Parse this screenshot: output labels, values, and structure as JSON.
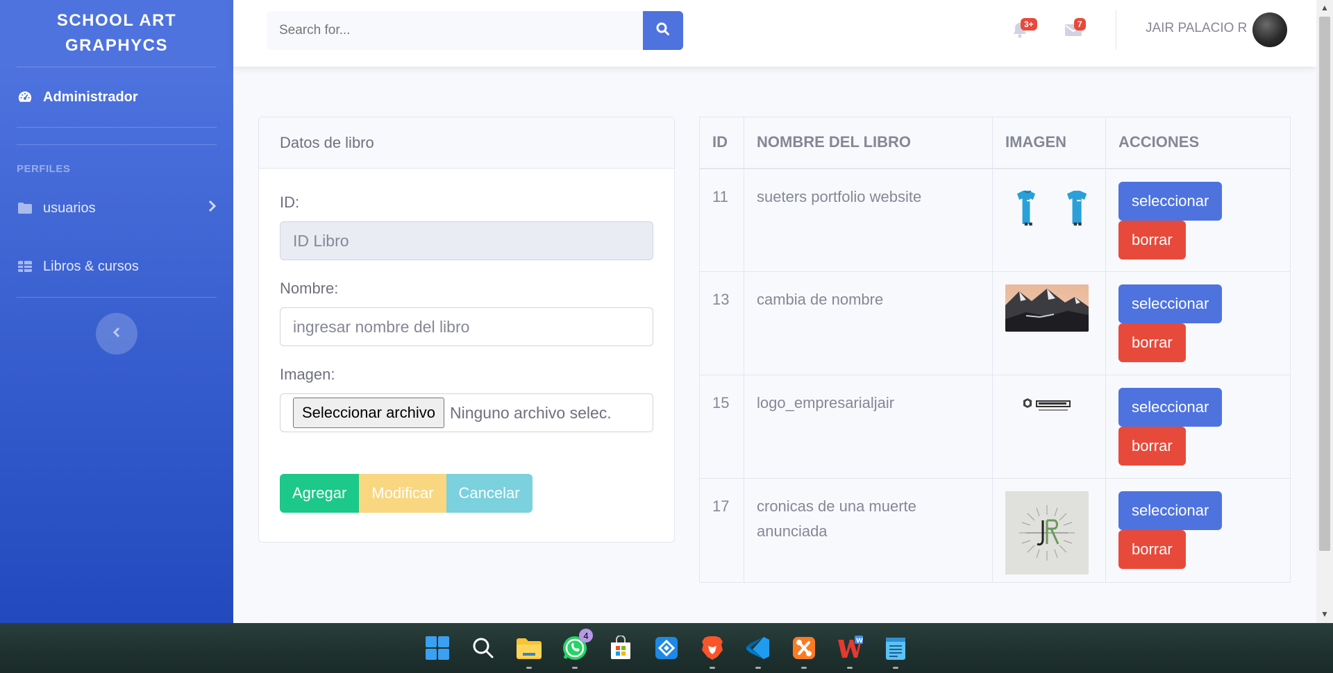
{
  "sidebar": {
    "brand_line1": "SCHOOL ART",
    "brand_line2": "GRAPHYCS",
    "dashboard_label": "Administrador",
    "heading": "PERFILES",
    "users_label": "usuarios",
    "books_label": "Libros & cursos"
  },
  "topbar": {
    "search_placeholder": "Search for...",
    "alerts_badge": "3+",
    "messages_badge": "7",
    "user_name": "JAIR PALACIO R"
  },
  "form": {
    "header": "Datos de libro",
    "id_label": "ID:",
    "id_placeholder": "ID Libro",
    "name_label": "Nombre:",
    "name_placeholder": "ingresar nombre del libro",
    "image_label": "Imagen:",
    "file_button": "Seleccionar archivo",
    "file_status": "Ninguno archivo selec.",
    "add_button": "Agregar",
    "modify_button": "Modificar",
    "cancel_button": "Cancelar"
  },
  "table": {
    "headers": [
      "ID",
      "NOMBRE DEL LIBRO",
      "IMAGEN",
      "ACCIONES"
    ],
    "select_label": "seleccionar",
    "delete_label": "borrar",
    "rows": [
      {
        "id": "11",
        "name": "sueters portfolio website",
        "image": "tshirts-thumbnail"
      },
      {
        "id": "13",
        "name": "cambia de nombre",
        "image": "mountain-thumbnail"
      },
      {
        "id": "15",
        "name": "logo_empresarialjair",
        "image": "logo-thumbnail"
      },
      {
        "id": "17",
        "name": "cronicas de una muerte anunciada",
        "image": "jr-logo-thumbnail"
      }
    ]
  },
  "taskbar": {
    "whatsapp_badge": "4",
    "apps": [
      "windows-start",
      "search",
      "file-explorer",
      "whatsapp",
      "microsoft-store",
      "anydesk",
      "brave-browser",
      "vscode",
      "xampp",
      "wps-office",
      "notepad"
    ]
  },
  "colors": {
    "primary": "#4e73df",
    "success": "#1cc88a",
    "warning": "#f6c23e",
    "info": "#36b9cc",
    "danger": "#e74a3b"
  }
}
